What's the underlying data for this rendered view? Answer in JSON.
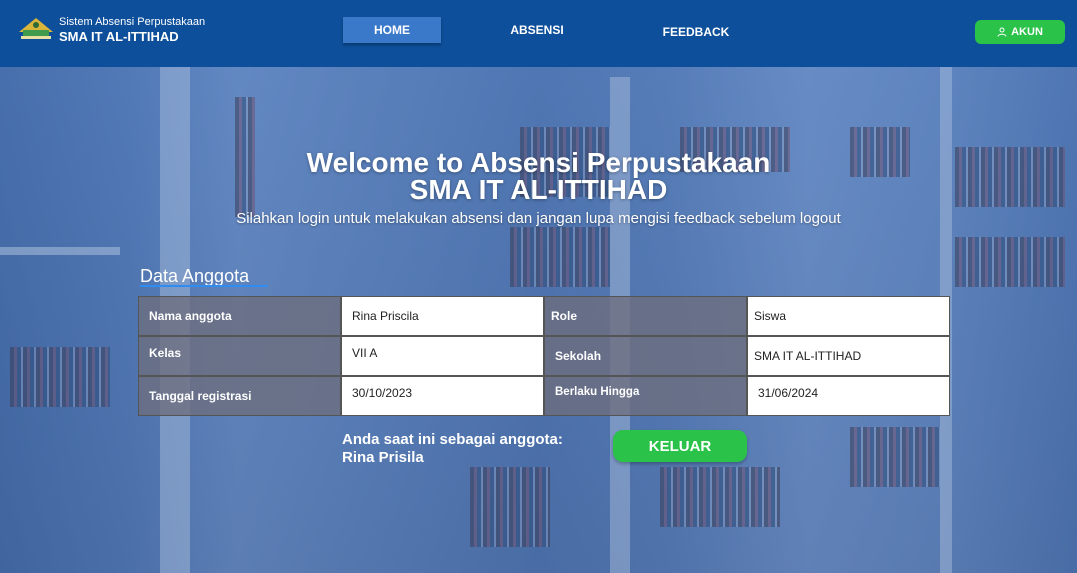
{
  "brand": {
    "subtitle": "Sistem Absensi Perpustakaan",
    "name": "SMA IT AL-ITTIHAD"
  },
  "nav": {
    "home": "HOME",
    "absensi": "ABSENSI",
    "feedback": "FEEDBACK",
    "akun": "AKUN"
  },
  "hero": {
    "title_line1": "Welcome to Absensi Perpustakaan",
    "title_line2": "SMA IT AL-ITTIHAD",
    "subtitle": "Silahkan login untuk melakukan  absensi dan jangan lupa mengisi feedback sebelum logout"
  },
  "member": {
    "section_title": "Data Anggota",
    "fields": {
      "nama_label": "Nama anggota",
      "nama_value": "Rina Priscila",
      "role_label": "Role",
      "role_value": "Siswa",
      "kelas_label": "Kelas",
      "kelas_value": "VII A",
      "sekolah_label": "Sekolah",
      "sekolah_value": "SMA IT AL-ITTIHAD",
      "tanggal_label": "Tanggal registrasi",
      "tanggal_value": "30/10/2023",
      "berlaku_label": "Berlaku Hingga",
      "berlaku_value": "31/06/2024"
    },
    "status_line1": "Anda saat ini sebagai anggota:",
    "status_line2": "Rina Prisila",
    "logout_button": "KELUAR"
  },
  "colors": {
    "header": "#0d4f9a",
    "accent_green": "#2bc24a",
    "home_active": "#3a78c9"
  },
  "icons": {
    "logo": "school-logo",
    "akun": "user-icon"
  }
}
